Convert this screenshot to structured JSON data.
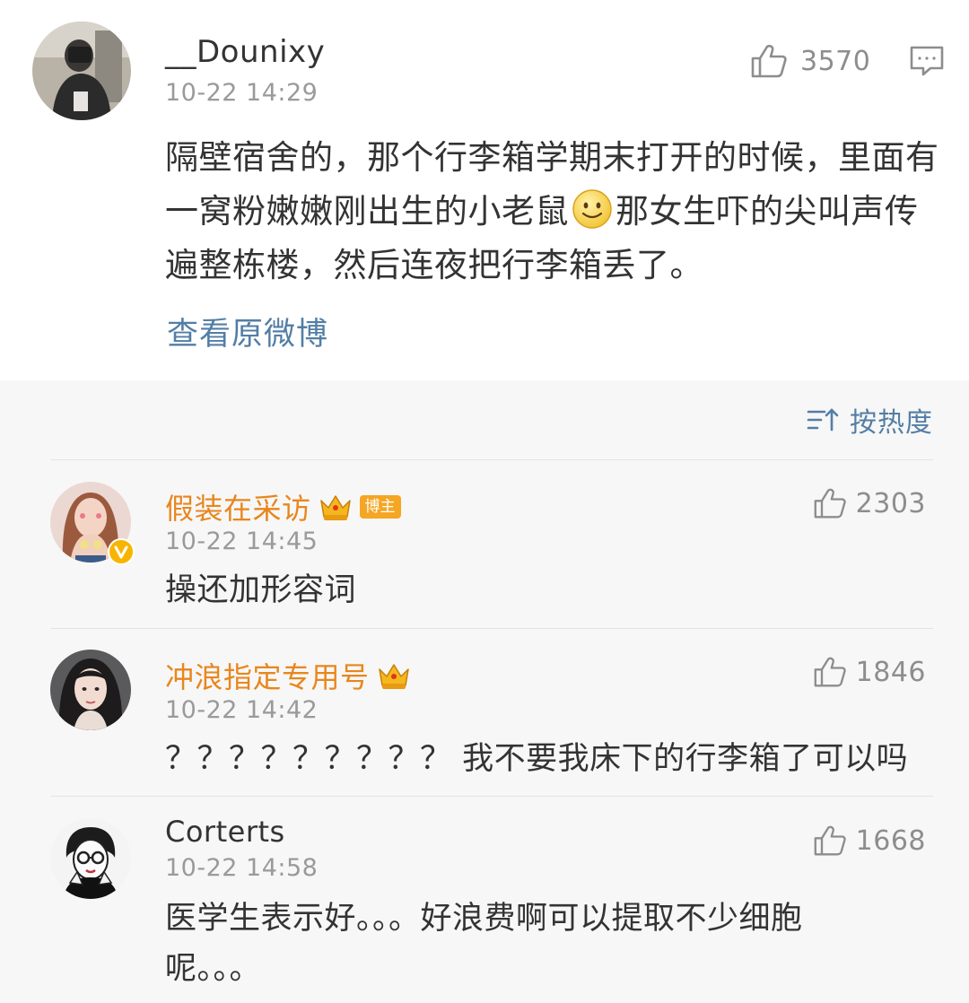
{
  "post": {
    "username": "__Dounixy",
    "timestamp": "10-22 14:29",
    "like_count": "3570",
    "text_part1": "隔壁宿舍的，那个行李箱学期末打开的时候，里面有一窝粉嫩嫩刚出生的小老鼠",
    "text_part2": "那女生吓的尖叫声传遍整栋楼，然后连夜把行李箱丢了。",
    "view_original": "查看原微博"
  },
  "sort": {
    "label": "按热度"
  },
  "comments": [
    {
      "username": "假装在采访",
      "badge": "博主",
      "timestamp": "10-22 14:45",
      "like_count": "2303",
      "text": "操还加形容词"
    },
    {
      "username": "冲浪指定专用号",
      "timestamp": "10-22 14:42",
      "like_count": "1846",
      "text": "？？？？？？？？？ 我不要我床下的行李箱了可以吗"
    },
    {
      "username": "Corterts",
      "timestamp": "10-22 14:58",
      "like_count": "1668",
      "text": "医学生表示好。。。好浪费啊可以提取不少细胞呢。。。"
    }
  ],
  "icons": {
    "like": "thumbs-up-icon",
    "comment": "comment-bubble-icon",
    "sort": "sort-icon",
    "crown": "crown-icon",
    "emoji": "smile-emoji-icon",
    "verified": "verified-v-icon"
  },
  "colors": {
    "vip_name": "#e8861c",
    "link": "#537ea5",
    "muted": "#9a9a9a",
    "badge": "#f5a623"
  }
}
